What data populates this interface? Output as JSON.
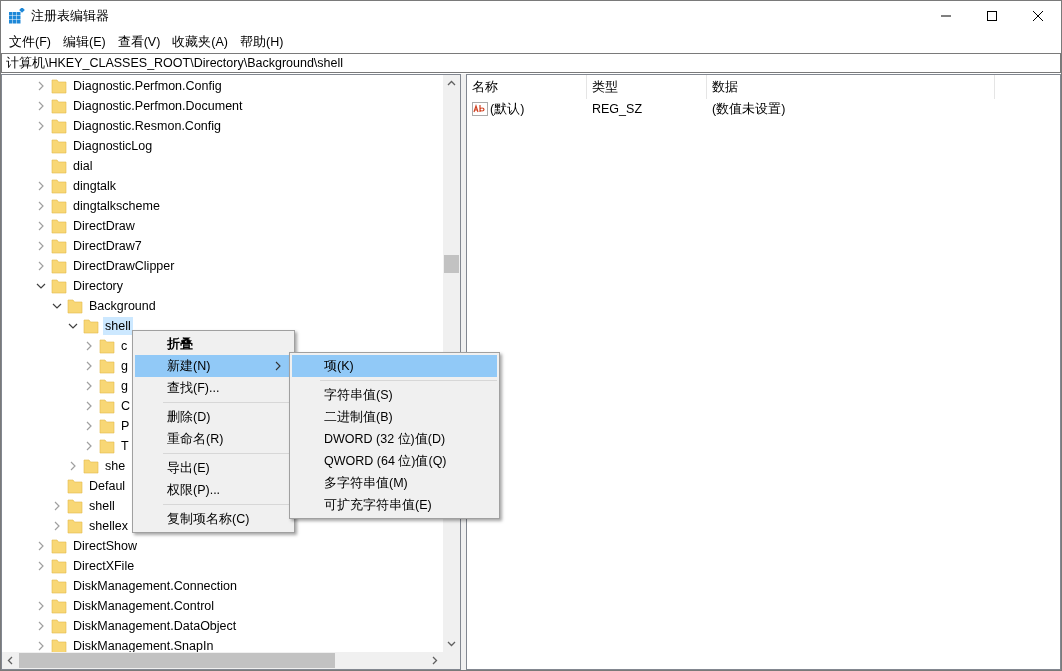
{
  "window": {
    "title": "注册表编辑器"
  },
  "menu_bar": [
    "文件(F)",
    "编辑(E)",
    "查看(V)",
    "收藏夹(A)",
    "帮助(H)"
  ],
  "address": "计算机\\HKEY_CLASSES_ROOT\\Directory\\Background\\shell",
  "tree": [
    {
      "label": "Diagnostic.Perfmon.Config",
      "expandable": true,
      "expanded": false,
      "selected": false
    },
    {
      "label": "Diagnostic.Perfmon.Document",
      "expandable": true,
      "expanded": false,
      "selected": false
    },
    {
      "label": "Diagnostic.Resmon.Config",
      "expandable": true,
      "expanded": false,
      "selected": false
    },
    {
      "label": "DiagnosticLog",
      "expandable": false,
      "selected": false
    },
    {
      "label": "dial",
      "expandable": false,
      "selected": false
    },
    {
      "label": "dingtalk",
      "expandable": true,
      "expanded": false,
      "selected": false
    },
    {
      "label": "dingtalkscheme",
      "expandable": true,
      "expanded": false,
      "selected": false
    },
    {
      "label": "DirectDraw",
      "expandable": true,
      "expanded": false,
      "selected": false
    },
    {
      "label": "DirectDraw7",
      "expandable": true,
      "expanded": false,
      "selected": false
    },
    {
      "label": "DirectDrawClipper",
      "expandable": true,
      "expanded": false,
      "selected": false
    },
    {
      "label": "Directory",
      "expandable": true,
      "expanded": true,
      "selected": false,
      "children": [
        {
          "label": "Background",
          "expandable": true,
          "expanded": true,
          "selected": false,
          "children": [
            {
              "label": "shell",
              "expandable": true,
              "expanded": true,
              "selected": true,
              "children": [
                {
                  "label": "c",
                  "expandable": true,
                  "expanded": false,
                  "selected": false
                },
                {
                  "label": "g",
                  "expandable": true,
                  "expanded": false,
                  "selected": false
                },
                {
                  "label": "g",
                  "expandable": true,
                  "expanded": false,
                  "selected": false
                },
                {
                  "label": "C",
                  "expandable": true,
                  "expanded": false,
                  "selected": false
                },
                {
                  "label": "P",
                  "expandable": true,
                  "expanded": false,
                  "selected": false
                },
                {
                  "label": "T",
                  "expandable": true,
                  "expanded": false,
                  "selected": false
                }
              ]
            },
            {
              "label": "she",
              "expandable": true,
              "expanded": false,
              "selected": false
            }
          ]
        },
        {
          "label": "Defaul",
          "expandable": false,
          "selected": false
        },
        {
          "label": "shell",
          "expandable": true,
          "expanded": false,
          "selected": false
        },
        {
          "label": "shellex",
          "expandable": true,
          "expanded": false,
          "selected": false
        }
      ]
    },
    {
      "label": "DirectShow",
      "expandable": true,
      "expanded": false,
      "selected": false
    },
    {
      "label": "DirectXFile",
      "expandable": true,
      "expanded": false,
      "selected": false
    },
    {
      "label": "DiskManagement.Connection",
      "expandable": false,
      "selected": false
    },
    {
      "label": "DiskManagement.Control",
      "expandable": true,
      "expanded": false,
      "selected": false
    },
    {
      "label": "DiskManagement.DataObject",
      "expandable": true,
      "expanded": false,
      "selected": false
    },
    {
      "label": "DiskManagement.SnapIn",
      "expandable": true,
      "expanded": false,
      "selected": false
    }
  ],
  "values_table": {
    "columns": [
      "名称",
      "类型",
      "数据"
    ],
    "rows": [
      {
        "name": "(默认)",
        "type": "REG_SZ",
        "data": "(数值未设置)"
      }
    ]
  },
  "context_menu": [
    {
      "label": "折叠",
      "default": true,
      "selected": false,
      "submenu": false,
      "separator_before": false
    },
    {
      "label": "新建(N)",
      "default": false,
      "selected": true,
      "submenu": true,
      "separator_before": false
    },
    {
      "label": "查找(F)...",
      "default": false,
      "selected": false,
      "submenu": false,
      "separator_before": false
    },
    {
      "label": "删除(D)",
      "default": false,
      "selected": false,
      "submenu": false,
      "separator_before": true
    },
    {
      "label": "重命名(R)",
      "default": false,
      "selected": false,
      "submenu": false,
      "separator_before": false
    },
    {
      "label": "导出(E)",
      "default": false,
      "selected": false,
      "submenu": false,
      "separator_before": true
    },
    {
      "label": "权限(P)...",
      "default": false,
      "selected": false,
      "submenu": false,
      "separator_before": false
    },
    {
      "label": "复制项名称(C)",
      "default": false,
      "selected": false,
      "submenu": false,
      "separator_before": true
    }
  ],
  "submenu": [
    {
      "label": "项(K)",
      "selected": true,
      "separator_before": false
    },
    {
      "label": "字符串值(S)",
      "selected": false,
      "separator_before": true
    },
    {
      "label": "二进制值(B)",
      "selected": false,
      "separator_before": false
    },
    {
      "label": "DWORD (32 位)值(D)",
      "selected": false,
      "separator_before": false
    },
    {
      "label": "QWORD (64 位)值(Q)",
      "selected": false,
      "separator_before": false
    },
    {
      "label": "多字符串值(M)",
      "selected": false,
      "separator_before": false
    },
    {
      "label": "可扩充字符串值(E)",
      "selected": false,
      "separator_before": false
    }
  ]
}
